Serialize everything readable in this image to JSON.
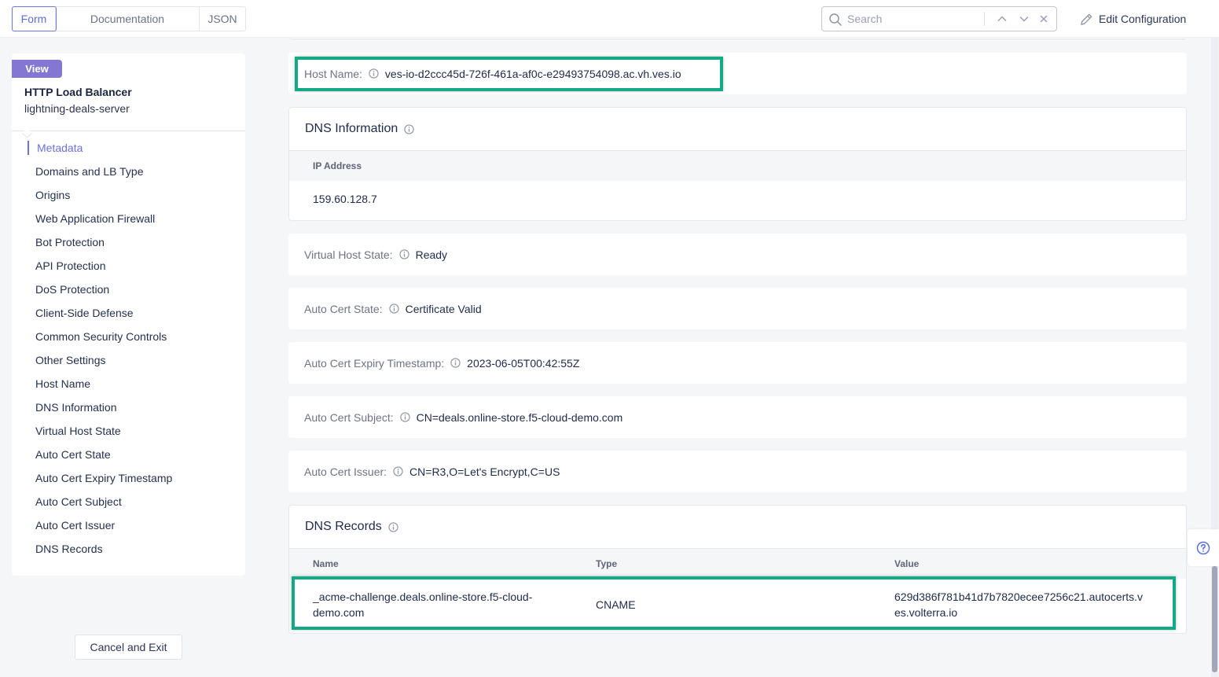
{
  "header": {
    "tabs": [
      {
        "label": "Form",
        "active": true
      },
      {
        "label": "Documentation",
        "active": false
      },
      {
        "label": "JSON",
        "active": false
      }
    ],
    "search": {
      "placeholder": "Search",
      "value": ""
    },
    "edit_configuration_label": "Edit Configuration"
  },
  "sidebar": {
    "badge": "View",
    "object_type": "HTTP Load Balancer",
    "object_name": "lightning-deals-server",
    "items": [
      {
        "label": "Metadata",
        "active": true
      },
      {
        "label": "Domains and LB Type"
      },
      {
        "label": "Origins"
      },
      {
        "label": "Web Application Firewall"
      },
      {
        "label": "Bot Protection"
      },
      {
        "label": "API Protection"
      },
      {
        "label": "DoS Protection"
      },
      {
        "label": "Client-Side Defense"
      },
      {
        "label": "Common Security Controls"
      },
      {
        "label": "Other Settings"
      },
      {
        "label": "Host Name"
      },
      {
        "label": "DNS Information"
      },
      {
        "label": "Virtual Host State"
      },
      {
        "label": "Auto Cert State"
      },
      {
        "label": "Auto Cert Expiry Timestamp"
      },
      {
        "label": "Auto Cert Subject"
      },
      {
        "label": "Auto Cert Issuer"
      },
      {
        "label": "DNS Records"
      }
    ],
    "cancel_label": "Cancel and Exit"
  },
  "main": {
    "host_name": {
      "label": "Host Name:",
      "value": "ves-io-d2ccc45d-726f-461a-af0c-e29493754098.ac.vh.ves.io"
    },
    "dns_information": {
      "title": "DNS Information",
      "columns": [
        "IP Address"
      ],
      "rows": [
        [
          "159.60.128.7"
        ]
      ]
    },
    "virtual_host_state": {
      "label": "Virtual Host State:",
      "value": "Ready"
    },
    "auto_cert_state": {
      "label": "Auto Cert State:",
      "value": "Certificate Valid"
    },
    "auto_cert_expiry": {
      "label": "Auto Cert Expiry Timestamp:",
      "value": "2023-06-05T00:42:55Z"
    },
    "auto_cert_subject": {
      "label": "Auto Cert Subject:",
      "value": "CN=deals.online-store.f5-cloud-demo.com"
    },
    "auto_cert_issuer": {
      "label": "Auto Cert Issuer:",
      "value": "CN=R3,O=Let's Encrypt,C=US"
    },
    "dns_records": {
      "title": "DNS Records",
      "columns": [
        "Name",
        "Type",
        "Value"
      ],
      "rows": [
        {
          "name_line1": "_acme-challenge.deals.online-store.f5-cloud-",
          "name_line2": "demo.com",
          "type": "CNAME",
          "value_line1": "629d386f781b41d7b7820ecee7256c21.autocerts.v",
          "value_line2": "es.volterra.io"
        }
      ]
    }
  },
  "colors": {
    "accent": "#5a6fe0",
    "badge": "#8477d3",
    "highlight": "#12aa86"
  }
}
